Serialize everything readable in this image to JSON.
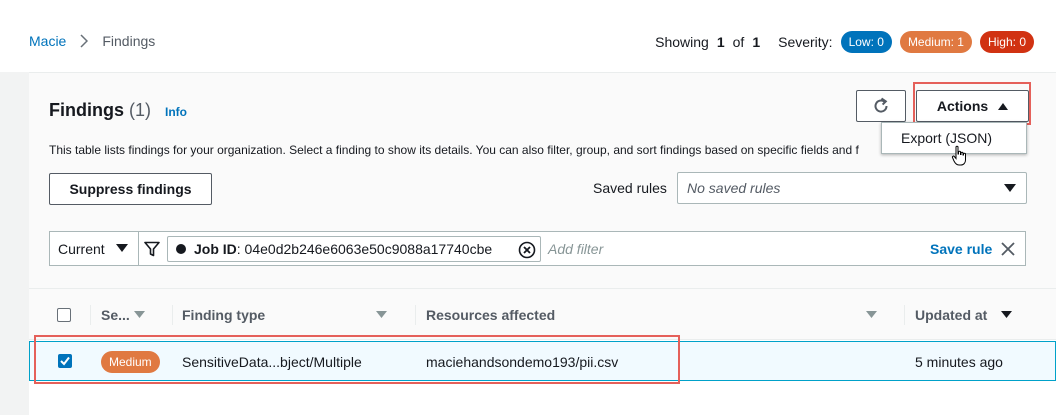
{
  "breadcrumb": {
    "root": "Macie",
    "current": "Findings"
  },
  "summary": {
    "showing_label": "Showing",
    "showing_current": "1",
    "of_label": "of",
    "showing_total": "1",
    "severity_label": "Severity:",
    "low": "Low: 0",
    "medium": "Medium: 1",
    "high": "High: 0"
  },
  "panel": {
    "title": "Findings",
    "count": "(1)",
    "info": "Info",
    "description": "This table lists findings for your organization. Select a finding to show its details. You can also filter, group, and sort findings based on specific fields and f"
  },
  "toolbar": {
    "refresh_icon": "refresh-icon",
    "actions_label": "Actions",
    "actions_menu": [
      "Export (JSON)"
    ],
    "suppress_label": "Suppress findings",
    "saved_rules_label": "Saved rules",
    "saved_rules_value": "No saved rules"
  },
  "filter": {
    "scope": "Current",
    "chip_key": "Job ID",
    "chip_value": ": 04e0d2b246e6063e50c9088a17740cbe",
    "add_placeholder": "Add filter",
    "save_rule": "Save rule"
  },
  "table": {
    "columns": [
      "Se...",
      "Finding type",
      "Resources affected",
      "Updated at"
    ],
    "rows": [
      {
        "selected": true,
        "severity": "Medium",
        "finding_type": "SensitiveData...bject/Multiple",
        "resource": "maciehandsondemo193/pii.csv",
        "updated": "5 minutes ago"
      }
    ]
  },
  "colors": {
    "link": "#0073bb",
    "low": "#0073bb",
    "medium": "#e07941",
    "high": "#d13212",
    "highlight": "#e5605a"
  }
}
